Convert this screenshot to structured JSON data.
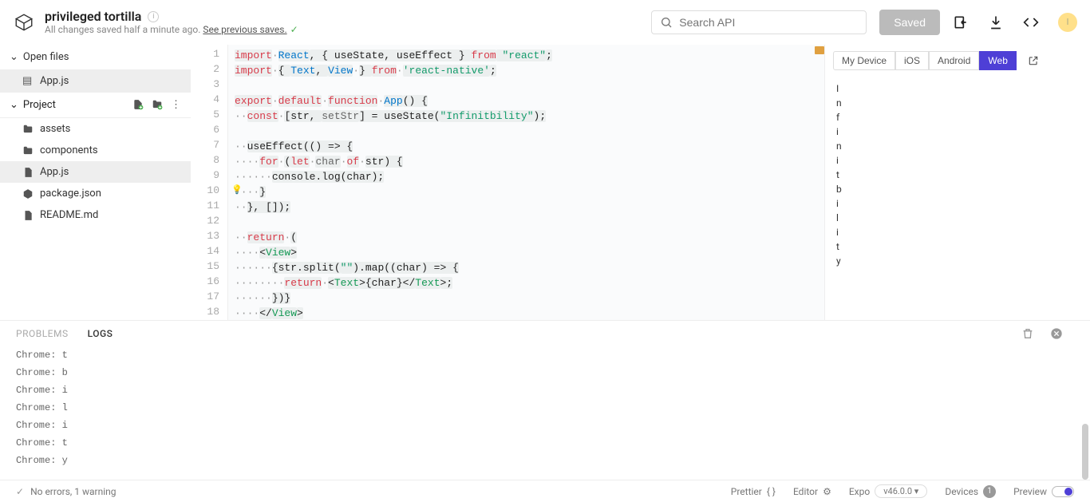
{
  "header": {
    "title": "privileged tortilla",
    "subtitle_prefix": "All changes saved half a minute ago. ",
    "subtitle_link": "See previous saves.",
    "search_placeholder": "Search API",
    "saved_button": "Saved",
    "avatar_initial": "I"
  },
  "sidebar": {
    "open_files_label": "Open files",
    "open_files": [
      {
        "name": "App.js",
        "icon": "js"
      }
    ],
    "project_label": "Project",
    "project_items": [
      {
        "name": "assets",
        "icon": "folder",
        "active": false
      },
      {
        "name": "components",
        "icon": "folder",
        "active": false
      },
      {
        "name": "App.js",
        "icon": "js",
        "active": true
      },
      {
        "name": "package.json",
        "icon": "pkg",
        "active": false
      },
      {
        "name": "README.md",
        "icon": "md",
        "active": false
      }
    ]
  },
  "editor": {
    "lines": [
      {
        "n": 1,
        "segs": [
          [
            "kw",
            "import"
          ],
          [
            "dot",
            "·"
          ],
          [
            "def",
            "React"
          ],
          [
            "",
            ", { useState, useEffect } "
          ],
          [
            "kw",
            "from"
          ],
          [
            "",
            ""
          ],
          [
            "str",
            " \"react\""
          ],
          [
            "",
            ";"
          ]
        ]
      },
      {
        "n": 2,
        "segs": [
          [
            "kw",
            "import"
          ],
          [
            "dot",
            "·"
          ],
          [
            "",
            "{ "
          ],
          [
            "def",
            "Text"
          ],
          [
            "",
            ", "
          ],
          [
            "def",
            "View"
          ],
          [
            "dot",
            "·"
          ],
          [
            "",
            "} "
          ],
          [
            "kw",
            "from"
          ],
          [
            "dot",
            "·"
          ],
          [
            "str",
            "'react-native'"
          ],
          [
            "",
            ";"
          ]
        ]
      },
      {
        "n": 3,
        "segs": [
          [
            "",
            ""
          ]
        ]
      },
      {
        "n": 4,
        "segs": [
          [
            "kw",
            "export"
          ],
          [
            "dot",
            "·"
          ],
          [
            "kw",
            "default"
          ],
          [
            "dot",
            "·"
          ],
          [
            "kw",
            "function"
          ],
          [
            "dot",
            "·"
          ],
          [
            "def",
            "App"
          ],
          [
            "",
            "() {"
          ]
        ]
      },
      {
        "n": 5,
        "segs": [
          [
            "dot",
            "··"
          ],
          [
            "kw",
            "const"
          ],
          [
            "dot",
            "·"
          ],
          [
            "",
            "[str, "
          ],
          [
            "var",
            "setStr"
          ],
          [
            "",
            "] = useState("
          ],
          [
            "str",
            "\"Infinitbility\""
          ],
          [
            "",
            ");"
          ]
        ]
      },
      {
        "n": 6,
        "segs": [
          [
            "",
            ""
          ]
        ]
      },
      {
        "n": 7,
        "segs": [
          [
            "dot",
            "··"
          ],
          [
            "",
            "useEffect(() => {"
          ]
        ]
      },
      {
        "n": 8,
        "segs": [
          [
            "dot",
            "····"
          ],
          [
            "kw",
            "for"
          ],
          [
            "dot",
            "·"
          ],
          [
            "",
            "("
          ],
          [
            "kw",
            "let"
          ],
          [
            "dot",
            "·"
          ],
          [
            "var",
            "char"
          ],
          [
            "dot",
            "·"
          ],
          [
            "kw",
            "of"
          ],
          [
            "dot",
            "·"
          ],
          [
            "",
            "str) {"
          ]
        ]
      },
      {
        "n": 9,
        "segs": [
          [
            "dot",
            "······"
          ],
          [
            "",
            "console.log(char);"
          ]
        ]
      },
      {
        "n": 10,
        "segs": [
          [
            "dot",
            "····"
          ],
          [
            "",
            "}"
          ]
        ]
      },
      {
        "n": 11,
        "segs": [
          [
            "dot",
            "··"
          ],
          [
            "",
            "}, []);"
          ]
        ]
      },
      {
        "n": 12,
        "segs": [
          [
            "",
            ""
          ]
        ]
      },
      {
        "n": 13,
        "segs": [
          [
            "dot",
            "··"
          ],
          [
            "kw",
            "return"
          ],
          [
            "dot",
            "·"
          ],
          [
            "",
            "("
          ]
        ]
      },
      {
        "n": 14,
        "segs": [
          [
            "dot",
            "····"
          ],
          [
            "",
            "<"
          ],
          [
            "tag",
            "View"
          ],
          [
            "",
            ">"
          ]
        ]
      },
      {
        "n": 15,
        "segs": [
          [
            "dot",
            "······"
          ],
          [
            "",
            "{str.split("
          ],
          [
            "str",
            "\"\""
          ],
          [
            "",
            ").map((char) => {"
          ]
        ]
      },
      {
        "n": 16,
        "segs": [
          [
            "dot",
            "········"
          ],
          [
            "kw",
            "return"
          ],
          [
            "dot",
            "·"
          ],
          [
            "",
            "<"
          ],
          [
            "tag",
            "Text"
          ],
          [
            "",
            ">{char}</"
          ],
          [
            "tag",
            "Text"
          ],
          [
            "",
            ">;"
          ]
        ]
      },
      {
        "n": 17,
        "segs": [
          [
            "dot",
            "······"
          ],
          [
            "",
            "})}"
          ]
        ]
      },
      {
        "n": 18,
        "segs": [
          [
            "dot",
            "····"
          ],
          [
            "",
            "</"
          ],
          [
            "tag",
            "View"
          ],
          [
            "",
            ">"
          ]
        ]
      }
    ]
  },
  "preview": {
    "tabs": [
      "My Device",
      "iOS",
      "Android",
      "Web"
    ],
    "active_tab": 3,
    "chars": [
      "I",
      "n",
      "f",
      "i",
      "n",
      "i",
      "t",
      "b",
      "i",
      "l",
      "i",
      "t",
      "y"
    ]
  },
  "panel": {
    "tabs": [
      "PROBLEMS",
      "LOGS"
    ],
    "active_tab": 1,
    "log_prefix": "Chrome:",
    "logs": [
      "t",
      "b",
      "i",
      "l",
      "i",
      "t",
      "y"
    ]
  },
  "status": {
    "left_text": "No errors, 1 warning",
    "prettier": "Prettier",
    "editor": "Editor",
    "expo": "Expo",
    "expo_version": "v46.0.0 ▾",
    "devices": "Devices",
    "devices_count": "1",
    "preview": "Preview"
  }
}
